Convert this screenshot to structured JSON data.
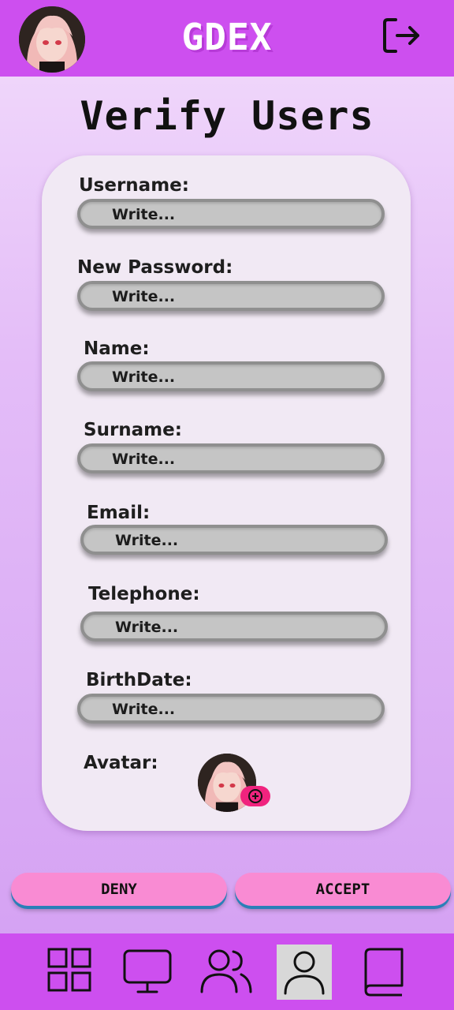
{
  "header": {
    "brand": "GDEX",
    "avatar_icon": "user-avatar-photo",
    "logout_icon": "logout-icon"
  },
  "page": {
    "title": "Verify Users"
  },
  "form": {
    "fields": [
      {
        "label": "Username:",
        "placeholder": "Write..."
      },
      {
        "label": "New Password:",
        "placeholder": "Write..."
      },
      {
        "label": "Name:",
        "placeholder": "Write..."
      },
      {
        "label": "Surname:",
        "placeholder": "Write..."
      },
      {
        "label": "Email:",
        "placeholder": "Write..."
      },
      {
        "label": "Telephone:",
        "placeholder": "Write..."
      },
      {
        "label": "BirthDate:",
        "placeholder": "Write..."
      }
    ],
    "avatar_label": "Avatar:",
    "avatar_add_icon": "plus-circle-icon"
  },
  "actions": {
    "deny": "DENY",
    "accept": "ACCEPT"
  },
  "nav": {
    "items": [
      {
        "icon": "grid-icon",
        "active": false
      },
      {
        "icon": "monitor-icon",
        "active": false
      },
      {
        "icon": "users-icon",
        "active": false
      },
      {
        "icon": "user-icon",
        "active": true
      },
      {
        "icon": "book-icon",
        "active": false
      }
    ]
  },
  "colors": {
    "header_bg": "#cd4fef",
    "button_bg": "#f98bd3",
    "button_shadow": "#2a7fb8",
    "badge": "#f0237e"
  }
}
